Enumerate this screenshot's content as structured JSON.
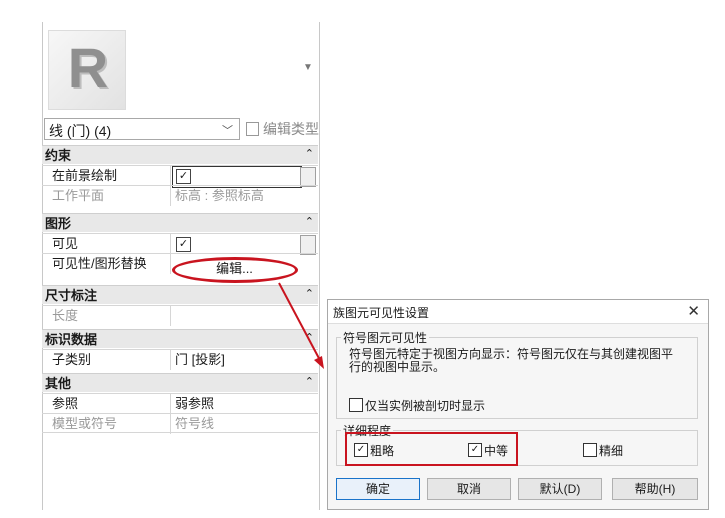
{
  "properties": {
    "type_selector": "线 (门) (4)",
    "edit_type_label": "编辑类型",
    "sections": {
      "constraints": {
        "title": "约束",
        "draw_in_foreground_label": "在前景绘制",
        "draw_in_foreground_checked": true,
        "work_plane_label": "工作平面",
        "work_plane_value": "标高 : 参照标高"
      },
      "graphics": {
        "title": "图形",
        "visible_label": "可见",
        "visible_checked": true,
        "vg_override_label": "可见性/图形替换",
        "vg_override_button": "编辑..."
      },
      "dimensions": {
        "title": "尺寸标注",
        "length_label": "长度",
        "length_value": ""
      },
      "identity": {
        "title": "标识数据",
        "subcategory_label": "子类别",
        "subcategory_value": "门 [投影]"
      },
      "other": {
        "title": "其他",
        "reference_label": "参照",
        "reference_value": "弱参照",
        "model_or_symbol_label": "模型或符号",
        "model_or_symbol_value": "符号线"
      }
    },
    "collapse_glyph": "⌃"
  },
  "dialog": {
    "title": "族图元可见性设置",
    "close_glyph": "✕",
    "symbol_group": {
      "title": "符号图元可见性",
      "description": "符号图元特定于视图方向显示：符号图元仅在与其创建视图平行的视图中显示。",
      "only_when_cut_label": "仅当实例被剖切时显示",
      "only_when_cut_checked": false
    },
    "detail_group": {
      "title": "详细程度",
      "coarse_label": "粗略",
      "coarse_checked": true,
      "medium_label": "中等",
      "medium_checked": true,
      "fine_label": "精细",
      "fine_checked": false
    },
    "buttons": {
      "ok": "确定",
      "cancel": "取消",
      "default": "默认(D)",
      "help": "帮助(H)"
    }
  },
  "colors": {
    "annotation_red": "#c9141f",
    "primary_button_border": "#1a73c9"
  }
}
